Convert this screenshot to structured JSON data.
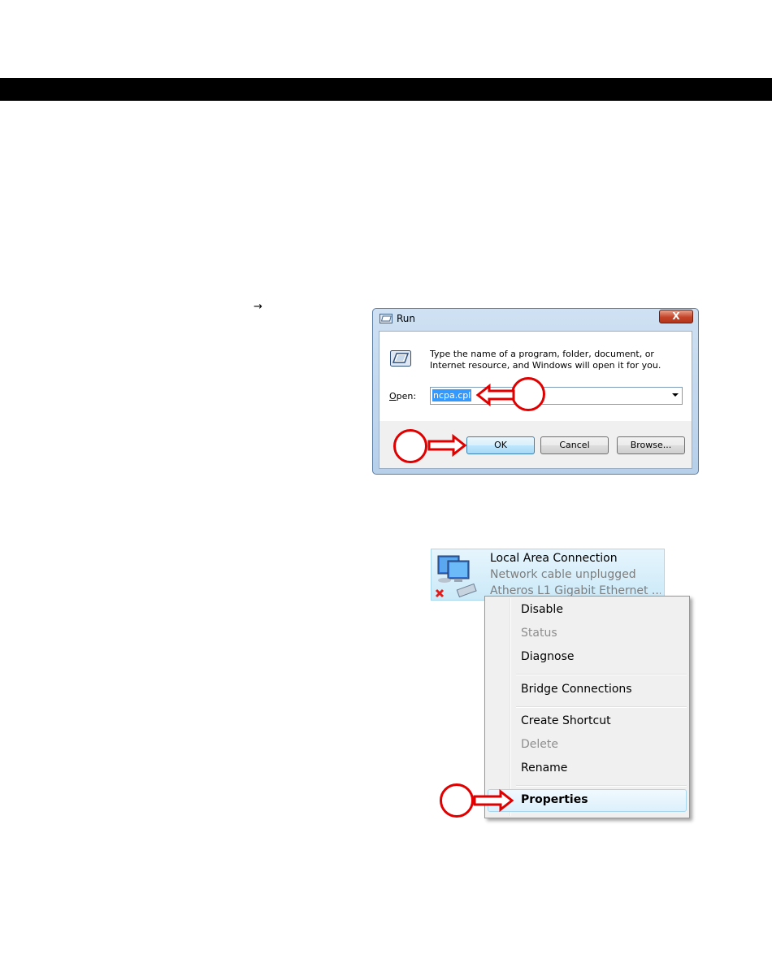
{
  "page": {
    "arrow_glyph": "→"
  },
  "run_dialog": {
    "title": "Run",
    "close_label": "X",
    "description": "Type the name of a program, folder, document, or Internet resource, and Windows will open it for you.",
    "open_label": "Open:",
    "open_value": "ncpa.cpl",
    "buttons": {
      "ok": "OK",
      "cancel": "Cancel",
      "browse": "Browse..."
    }
  },
  "network_connection": {
    "name": "Local Area Connection",
    "status": "Network cable unplugged",
    "adapter": "Atheros L1 Gigabit Ethernet ..."
  },
  "context_menu": {
    "items": [
      {
        "label": "Disable",
        "enabled": true
      },
      {
        "label": "Status",
        "enabled": false
      },
      {
        "label": "Diagnose",
        "enabled": true
      },
      {
        "label": "Bridge Connections",
        "enabled": true
      },
      {
        "label": "Create Shortcut",
        "enabled": true
      },
      {
        "label": "Delete",
        "enabled": false
      },
      {
        "label": "Rename",
        "enabled": true
      },
      {
        "label": "Properties",
        "enabled": true,
        "default": true,
        "highlighted": true
      }
    ]
  },
  "colors": {
    "annotation_red": "#e00000",
    "header_bar": "#000000",
    "selection_blue": "#3399ff"
  }
}
